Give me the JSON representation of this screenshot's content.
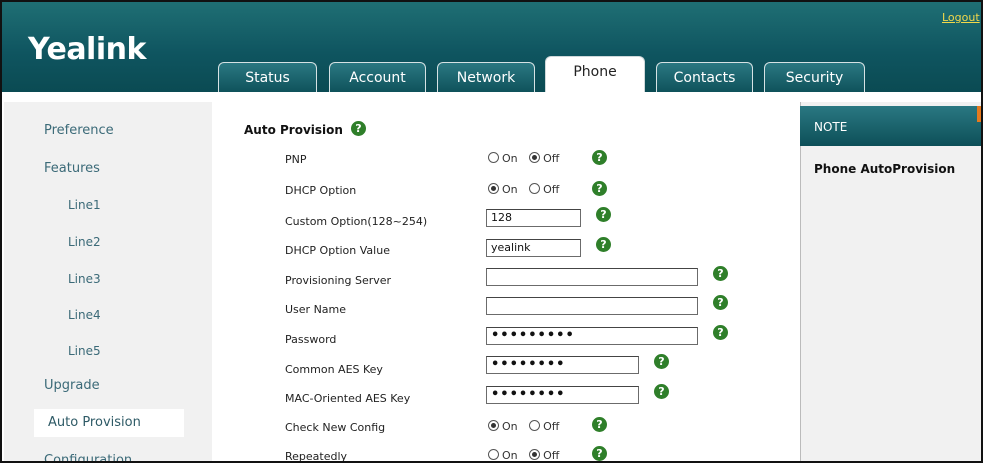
{
  "header": {
    "logo": "Yealink",
    "logout": "Logout",
    "tabs": [
      {
        "label": "Status"
      },
      {
        "label": "Account"
      },
      {
        "label": "Network"
      },
      {
        "label": "Phone"
      },
      {
        "label": "Contacts"
      },
      {
        "label": "Security"
      }
    ],
    "active_tab": "Phone"
  },
  "sidebar": {
    "items": [
      {
        "label": "Preference"
      },
      {
        "label": "Features"
      },
      {
        "label": "Line1"
      },
      {
        "label": "Line2"
      },
      {
        "label": "Line3"
      },
      {
        "label": "Line4"
      },
      {
        "label": "Line5"
      },
      {
        "label": "Upgrade"
      },
      {
        "label": "Auto Provision"
      },
      {
        "label": "Configuration"
      }
    ],
    "active": "Auto Provision"
  },
  "form": {
    "title": "Auto Provision",
    "on_label": "On",
    "off_label": "Off",
    "help_glyph": "?",
    "pnp": {
      "label": "PNP",
      "value": "Off"
    },
    "dhcp_option": {
      "label": "DHCP Option",
      "value": "On"
    },
    "custom_option": {
      "label": "Custom Option(128~254)",
      "value": "128"
    },
    "dhcp_option_value": {
      "label": "DHCP Option Value",
      "value": "yealink"
    },
    "provisioning_server": {
      "label": "Provisioning Server",
      "value": ""
    },
    "user_name": {
      "label": "User Name",
      "value": ""
    },
    "password": {
      "label": "Password",
      "value": "•••••••••"
    },
    "common_aes_key": {
      "label": "Common AES Key",
      "value": "••••••••"
    },
    "mac_aes_key": {
      "label": "MAC-Oriented AES Key",
      "value": "••••••••"
    },
    "check_new_config": {
      "label": "Check New Config",
      "value": "On"
    },
    "repeatedly": {
      "label": "Repeatedly",
      "value": "Off"
    }
  },
  "note": {
    "heading": "NOTE",
    "body": "Phone AutoProvision"
  },
  "colors": {
    "header_teal": "#0f5560",
    "nav_text": "#3b6a78",
    "help_green": "#2f7f2a",
    "logout_yellow": "#f2d84a",
    "note_accent": "#e67a1e"
  }
}
